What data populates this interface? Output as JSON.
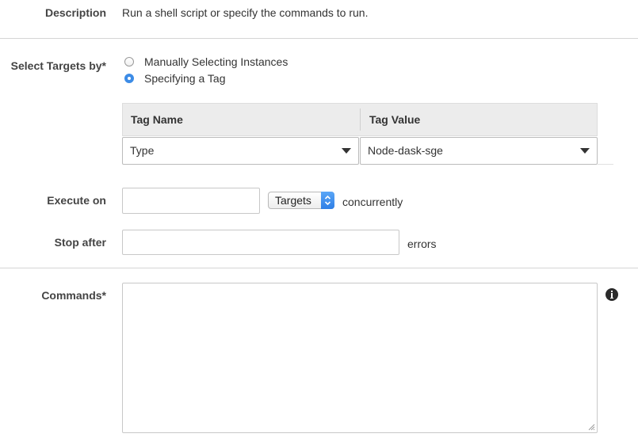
{
  "description": {
    "label": "Description",
    "text": "Run a shell script or specify the commands to run."
  },
  "select_targets": {
    "label": "Select Targets by*",
    "options": [
      {
        "label": "Manually Selecting Instances",
        "selected": false
      },
      {
        "label": "Specifying a Tag",
        "selected": true
      }
    ]
  },
  "tag_table": {
    "headers": {
      "name": "Tag Name",
      "value": "Tag Value"
    },
    "row": {
      "name": "Type",
      "value": "Node-dask-sge"
    }
  },
  "execute_on": {
    "label": "Execute on",
    "value": "",
    "unit_select": "Targets",
    "suffix": "concurrently"
  },
  "stop_after": {
    "label": "Stop after",
    "value": "",
    "suffix": "errors"
  },
  "commands": {
    "label": "Commands*",
    "value": "",
    "info_icon": "info-icon"
  },
  "colors": {
    "accent": "#3d8ce6",
    "header_bg": "#ececec",
    "divider": "#d5d5d5"
  }
}
